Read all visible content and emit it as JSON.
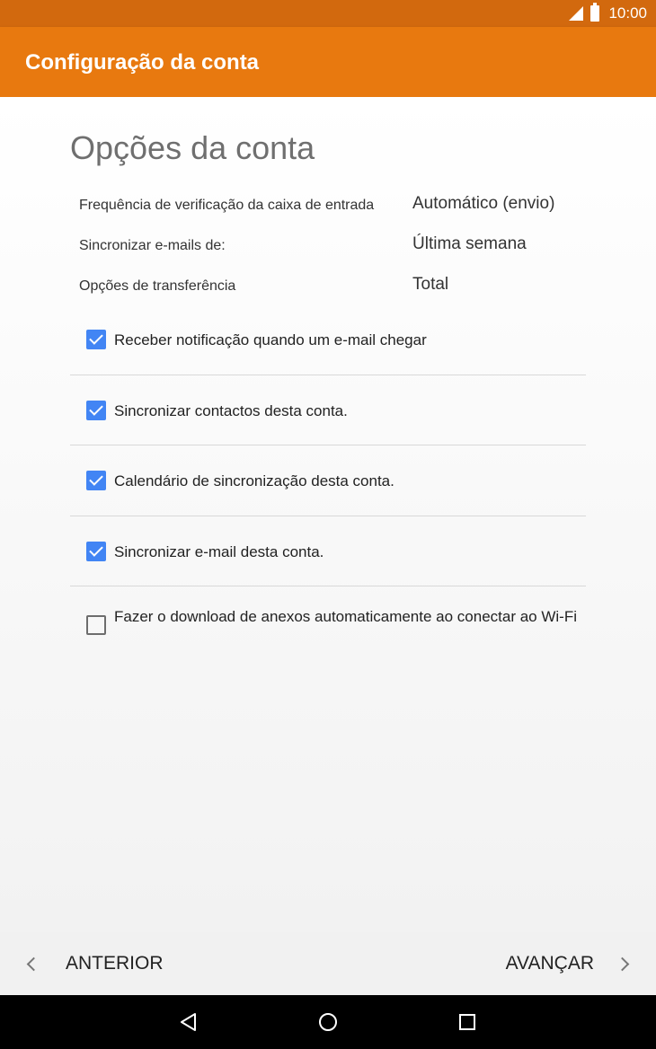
{
  "status_bar": {
    "time": "10:00",
    "icons": [
      "signal-icon",
      "battery-icon"
    ]
  },
  "app_bar": {
    "title": "Configuração da conta"
  },
  "page": {
    "section_title": "Opções da conta",
    "settings": [
      {
        "label": "Frequência de verificação da caixa de entrada",
        "value": "Automático (envio)"
      },
      {
        "label": "Sincronizar e-mails de:",
        "value": "Última semana"
      },
      {
        "label": "Opções de transferência",
        "value": "Total"
      }
    ],
    "checkboxes": [
      {
        "label": "Receber notificação quando um e-mail chegar",
        "checked": true
      },
      {
        "label": "Sincronizar contactos desta conta.",
        "checked": true
      },
      {
        "label": "Calendário de sincronização desta conta.",
        "checked": true
      },
      {
        "label": "Sincronizar e-mail desta conta.",
        "checked": true
      },
      {
        "label": "Fazer o download de anexos automaticamente ao conectar ao Wi-Fi",
        "checked": false
      }
    ]
  },
  "bottom_nav": {
    "prev_label": "ANTERIOR",
    "next_label": "AVANÇAR"
  },
  "colors": {
    "status_bar": "#d2690e",
    "app_bar": "#e8790f",
    "checkbox_accent": "#4285f4"
  }
}
